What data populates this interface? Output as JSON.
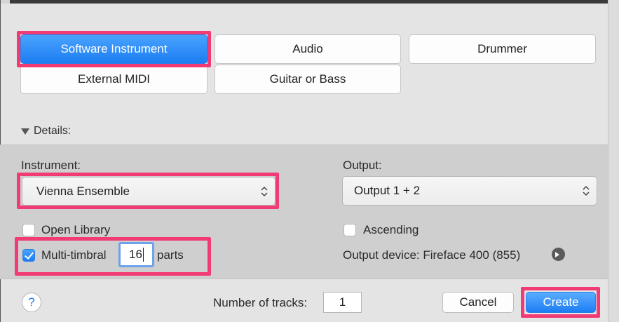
{
  "track_types": [
    {
      "label": "Software Instrument",
      "selected": true
    },
    {
      "label": "Audio",
      "selected": false
    },
    {
      "label": "Drummer",
      "selected": false
    },
    {
      "label": "External MIDI",
      "selected": false
    },
    {
      "label": "Guitar or Bass",
      "selected": false
    }
  ],
  "details": {
    "toggle_label": "Details:",
    "instrument_label": "Instrument:",
    "instrument_value": "Vienna Ensemble",
    "output_label": "Output:",
    "output_value": "Output 1 + 2",
    "open_library_label": "Open Library",
    "open_library_checked": false,
    "ascending_label": "Ascending",
    "ascending_checked": false,
    "multitimbral_label": "Multi-timbral",
    "multitimbral_checked": true,
    "parts_value": "16",
    "parts_label": "parts",
    "output_device_text": "Output device: Fireface 400 (855)"
  },
  "footer": {
    "help_label": "?",
    "tracks_label": "Number of tracks:",
    "tracks_value": "1",
    "cancel_label": "Cancel",
    "create_label": "Create"
  },
  "colors": {
    "accent": "#1d7df2",
    "highlight": "#f23a74"
  }
}
